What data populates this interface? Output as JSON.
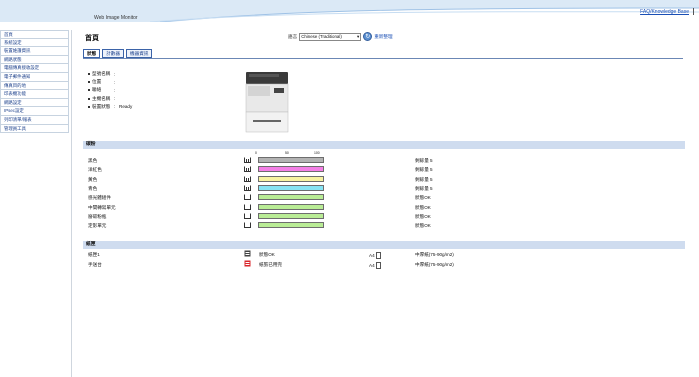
{
  "header": {
    "app_title": "Web Image Monitor",
    "help_link": "FAQ/Knowledge Base"
  },
  "sidebar": {
    "items": [
      {
        "label": "首頁"
      },
      {
        "label": "系統設定"
      },
      {
        "label": "裝置維護資訊"
      },
      {
        "label": "網路狀態"
      },
      {
        "label": "電腦傳真接收設定"
      },
      {
        "label": "電子郵件通知"
      },
      {
        "label": "傳真目的地"
      },
      {
        "label": "印表機功能"
      },
      {
        "label": "網路設定"
      },
      {
        "label": "IPsec設定"
      },
      {
        "label": "列印清單/報表"
      },
      {
        "label": "管理員工具"
      }
    ]
  },
  "main": {
    "page_title": "首頁",
    "language_label": "語言",
    "language_value": "Chinese (Traditional)",
    "refresh_label": "重新整理",
    "tabs": [
      {
        "label": "狀態",
        "active": true
      },
      {
        "label": "計數器",
        "active": false
      },
      {
        "label": "機器資訊",
        "active": false
      }
    ],
    "info": [
      {
        "label": "型號名稱",
        "value": ""
      },
      {
        "label": "位置",
        "value": ""
      },
      {
        "label": "聯絡",
        "value": ""
      },
      {
        "label": "主機名稱",
        "value": ""
      },
      {
        "label": "裝置狀態",
        "value": "Ready"
      }
    ],
    "consumables_header": "碳粉",
    "scale_labels": [
      "0",
      "50",
      "100"
    ],
    "consumables": [
      {
        "name": "黑色",
        "fill_fraction": 1.0,
        "color": "#b3b3b3",
        "status": "剩餘量 5"
      },
      {
        "name": "洋紅色",
        "fill_fraction": 1.0,
        "color": "#f47fe6",
        "status": "剩餘量 5"
      },
      {
        "name": "黃色",
        "fill_fraction": 1.0,
        "color": "#f6f2a0",
        "status": "剩餘量 5"
      },
      {
        "name": "青色",
        "fill_fraction": 1.0,
        "color": "#87e3f3",
        "status": "剩餘量 5"
      },
      {
        "name": "感光體組件",
        "fill_fraction": 1.0,
        "color": "#b9ec95",
        "status": "狀態OK"
      },
      {
        "name": "中間轉寫單元",
        "fill_fraction": 1.0,
        "color": "#b9ec95",
        "status": "狀態OK"
      },
      {
        "name": "廢碳粉瓶",
        "fill_fraction": 1.0,
        "color": "#b9ec95",
        "status": "狀態OK"
      },
      {
        "name": "定影單元",
        "fill_fraction": 1.0,
        "color": "#b9ec95",
        "status": "狀態OK"
      }
    ],
    "trays_header": "紙匣",
    "trays": [
      {
        "name": "紙匣1",
        "status": "狀態OK",
        "size": "A4",
        "type": "中厚紙(75-90g/m2)",
        "icon_color": "#444444"
      },
      {
        "name": "手送台",
        "status": "紙張已用完",
        "size": "A4",
        "type": "中厚紙(75-90g/m2)",
        "icon_color": "#d9262b"
      }
    ]
  }
}
